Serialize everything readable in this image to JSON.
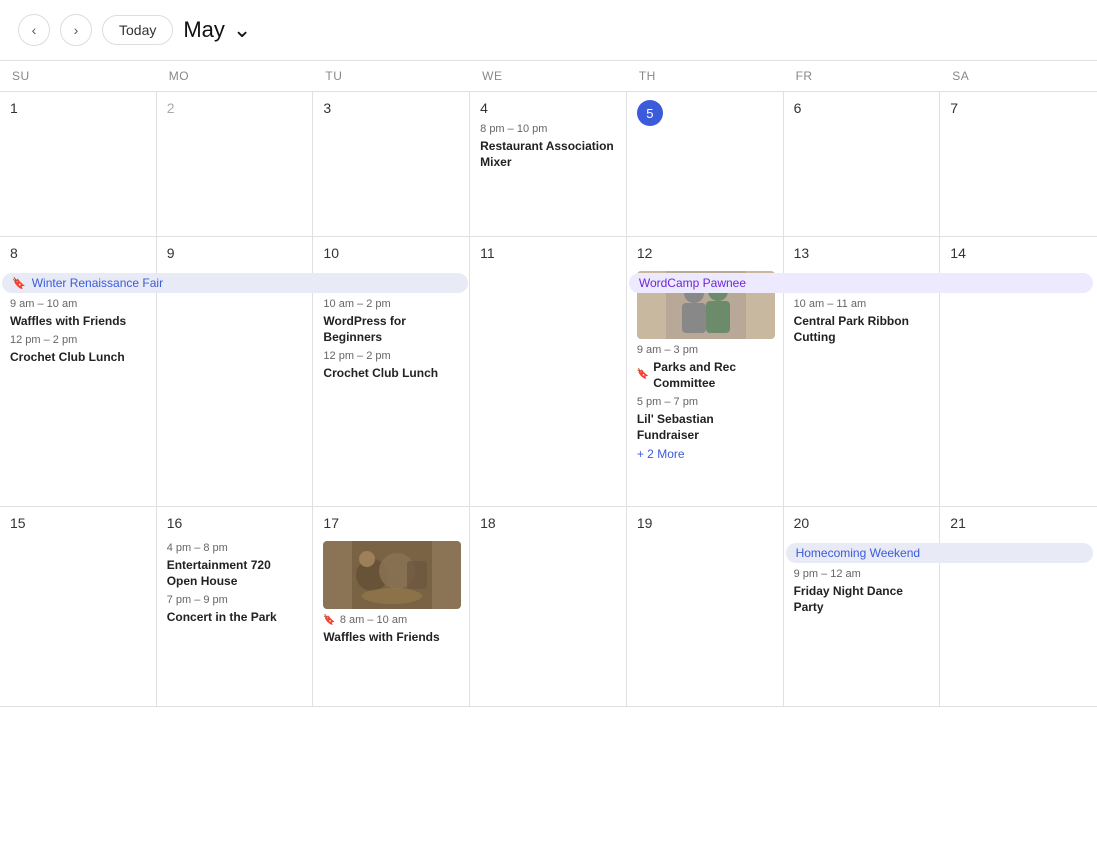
{
  "header": {
    "prev_label": "‹",
    "next_label": "›",
    "today_label": "Today",
    "month_label": "May",
    "chevron": "⌄"
  },
  "day_headers": [
    "SU",
    "MO",
    "TU",
    "WE",
    "TH",
    "FR",
    "SA"
  ],
  "weeks": [
    {
      "id": "week1",
      "multi_day": [],
      "days": [
        {
          "num": "1",
          "type": "normal",
          "events": []
        },
        {
          "num": "2",
          "type": "gray",
          "events": []
        },
        {
          "num": "3",
          "type": "normal",
          "events": []
        },
        {
          "num": "4",
          "type": "normal",
          "events": [
            {
              "time": "8 pm – 10 pm",
              "title": "Restaurant Association Mixer"
            }
          ]
        },
        {
          "num": "5",
          "type": "today",
          "events": []
        },
        {
          "num": "6",
          "type": "normal",
          "events": []
        },
        {
          "num": "7",
          "type": "normal",
          "events": []
        }
      ]
    },
    {
      "id": "week2",
      "multi_day": [
        {
          "label": "Winter Renaissance Fair",
          "style": "lavender",
          "flag": true,
          "col_start": 1,
          "col_span": 3
        },
        {
          "label": "WordCamp Pawnee",
          "style": "purple",
          "flag": false,
          "col_start": 5,
          "col_span": 3
        }
      ],
      "days": [
        {
          "num": "8",
          "type": "normal",
          "events": []
        },
        {
          "num": "9",
          "type": "normal",
          "events": []
        },
        {
          "num": "10",
          "type": "normal",
          "events": [
            {
              "time": "10 am – 2 pm",
              "title": "WordPress for Beginners"
            },
            {
              "time": "12 pm – 2 pm",
              "title": "Crochet Club Lunch"
            }
          ]
        },
        {
          "num": "11",
          "type": "normal",
          "events": []
        },
        {
          "num": "12",
          "type": "normal",
          "has_image": true,
          "image_type": "people",
          "events": [
            {
              "time": "9 am – 3 pm",
              "title": "Parks and Rec Committee",
              "flag": true
            },
            {
              "time": "5 pm – 7 pm",
              "title": "Lil' Sebastian Fundraiser"
            },
            {
              "more": "+2 More"
            }
          ],
          "extra_events": [
            {
              "time": "9 am – 10 am",
              "title": "Waffles with Friends"
            },
            {
              "time": "12 pm – 2 pm",
              "title": "Crochet Club Lunch"
            }
          ]
        },
        {
          "num": "13",
          "type": "normal",
          "events": [
            {
              "time": "10 am – 11 am",
              "title": "Central Park Ribbon Cutting"
            }
          ]
        },
        {
          "num": "14",
          "type": "normal",
          "events": []
        }
      ]
    },
    {
      "id": "week3",
      "multi_day": [
        {
          "label": "Homecoming Weekend",
          "style": "lavender",
          "flag": false,
          "col_start": 6,
          "col_span": 2
        }
      ],
      "days": [
        {
          "num": "15",
          "type": "normal",
          "events": []
        },
        {
          "num": "16",
          "type": "normal",
          "events": [
            {
              "time": "4 pm – 8 pm",
              "title": "Entertainment 720 Open House"
            },
            {
              "time": "7 pm – 9 pm",
              "title": "Concert in the Park"
            }
          ]
        },
        {
          "num": "17",
          "type": "normal",
          "has_image": true,
          "image_type": "food",
          "events": [
            {
              "time": "8 am – 10 am",
              "title": "Waffles with Friends",
              "flag": true
            }
          ]
        },
        {
          "num": "18",
          "type": "normal",
          "events": []
        },
        {
          "num": "19",
          "type": "normal",
          "events": []
        },
        {
          "num": "20",
          "type": "normal",
          "events": [
            {
              "time": "9 pm – 12 am",
              "title": "Friday Night Dance Party"
            }
          ]
        },
        {
          "num": "21",
          "type": "normal",
          "events": []
        }
      ]
    }
  ],
  "week1_events": {
    "day8_extra": [
      {
        "time": "9 am – 10 am",
        "title": "Waffles with Friends"
      },
      {
        "time": "12 pm – 2 pm",
        "title": "Crochet Club Lunch"
      }
    ]
  }
}
